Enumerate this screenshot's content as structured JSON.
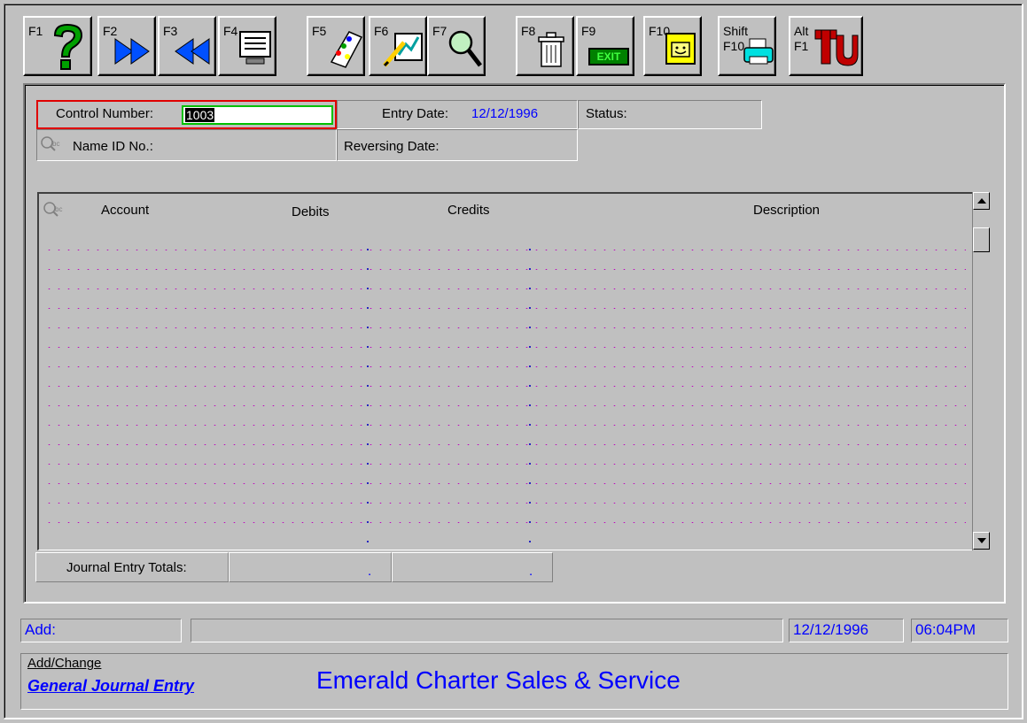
{
  "toolbar": {
    "buttons": [
      {
        "key": "F1",
        "icon": "help-question-icon"
      },
      {
        "key": "F2",
        "icon": "next-arrow-icon"
      },
      {
        "key": "F3",
        "icon": "previous-arrow-icon"
      },
      {
        "key": "F4",
        "icon": "monitor-list-icon"
      },
      {
        "key": "F5",
        "icon": "color-palette-icon"
      },
      {
        "key": "F6",
        "icon": "pencil-chart-icon"
      },
      {
        "key": "F7",
        "icon": "magnifier-search-icon"
      },
      {
        "key": "F8",
        "icon": "trash-can-icon"
      },
      {
        "key": "F9",
        "icon": "exit-sign-icon",
        "sublabel": "EXIT"
      },
      {
        "key": "F10",
        "icon": "smiley-note-icon"
      },
      {
        "key": "Shift",
        "key2": "F10",
        "icon": "printer-icon"
      },
      {
        "key": "Alt",
        "key2": "F1",
        "icon": "tu-logo-icon"
      }
    ]
  },
  "header": {
    "control_number_label": "Control Number:",
    "control_number_value": "1003",
    "entry_date_label": "Entry Date:",
    "entry_date_value": "12/12/1996",
    "status_label": "Status:",
    "name_id_label": "Name ID No.:",
    "reversing_date_label": "Reversing Date:"
  },
  "grid": {
    "columns": [
      "Account",
      "Debits",
      "Credits",
      "Description"
    ],
    "rows": []
  },
  "totals": {
    "label": "Journal Entry Totals:",
    "debits": ".",
    "credits": "."
  },
  "statusbar": {
    "mode": "Add:",
    "message": "",
    "date": "12/12/1996",
    "time": "06:04PM"
  },
  "footer": {
    "mode_label": "Add/Change",
    "screen_title": "General Journal Entry",
    "company_name": "Emerald Charter Sales & Service"
  },
  "colors": {
    "background": "#c0c0c0",
    "accent_blue": "#0000ff",
    "focus_red": "#e00000",
    "input_green": "#00c000",
    "grid_dots": "#c000c0"
  }
}
